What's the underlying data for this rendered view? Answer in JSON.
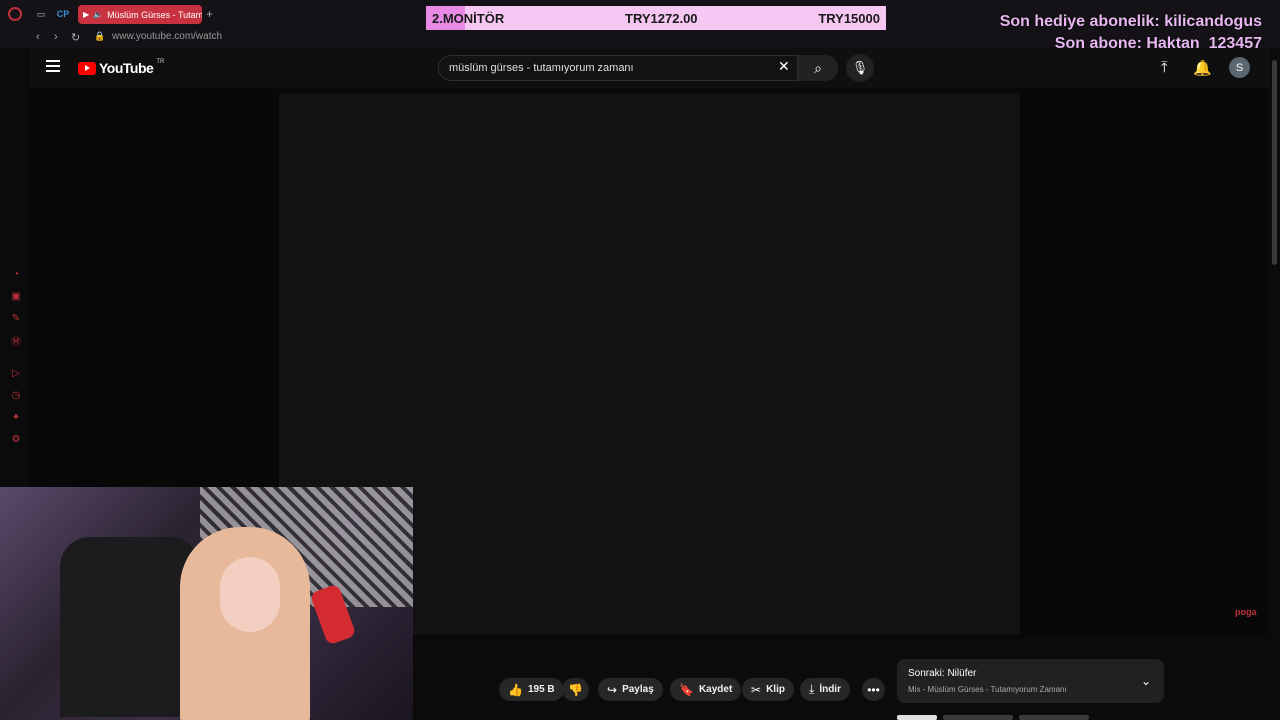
{
  "browser": {
    "active_tab_title": "Müslüm Gürses - Tutam",
    "url": "www.youtube.com/watch"
  },
  "overlay": {
    "goal_label": "2.MONİTÖR",
    "goal_current": "TRY1272.00",
    "goal_target": "TRY15000",
    "goal_progress": 0.085,
    "last_gift_sub": "Son hediye abonelik: kilicandogus",
    "last_sub": "Son abone: Haktan_123457",
    "watermark": "poga"
  },
  "youtube": {
    "logo_text": "YouTube",
    "country_code": "TR",
    "search_query": "müslüm gürses - tutamıyorum zamanı",
    "avatar_letter": "S"
  },
  "actions": {
    "like_count": "195 B",
    "share_label": "Paylaş",
    "save_label": "Kaydet",
    "clip_label": "Klip",
    "download_label": "İndir"
  },
  "up_next": {
    "title": "Sonraki: Nilüfer",
    "subtitle": "Mix - Müslüm Gürses - Tutamıyorum Zamanı"
  },
  "colors": {
    "accent": "#c8323f",
    "goal_bg": "#f7c7f3",
    "goal_fill": "#e889e6",
    "sub_text": "#e7b7f0"
  }
}
